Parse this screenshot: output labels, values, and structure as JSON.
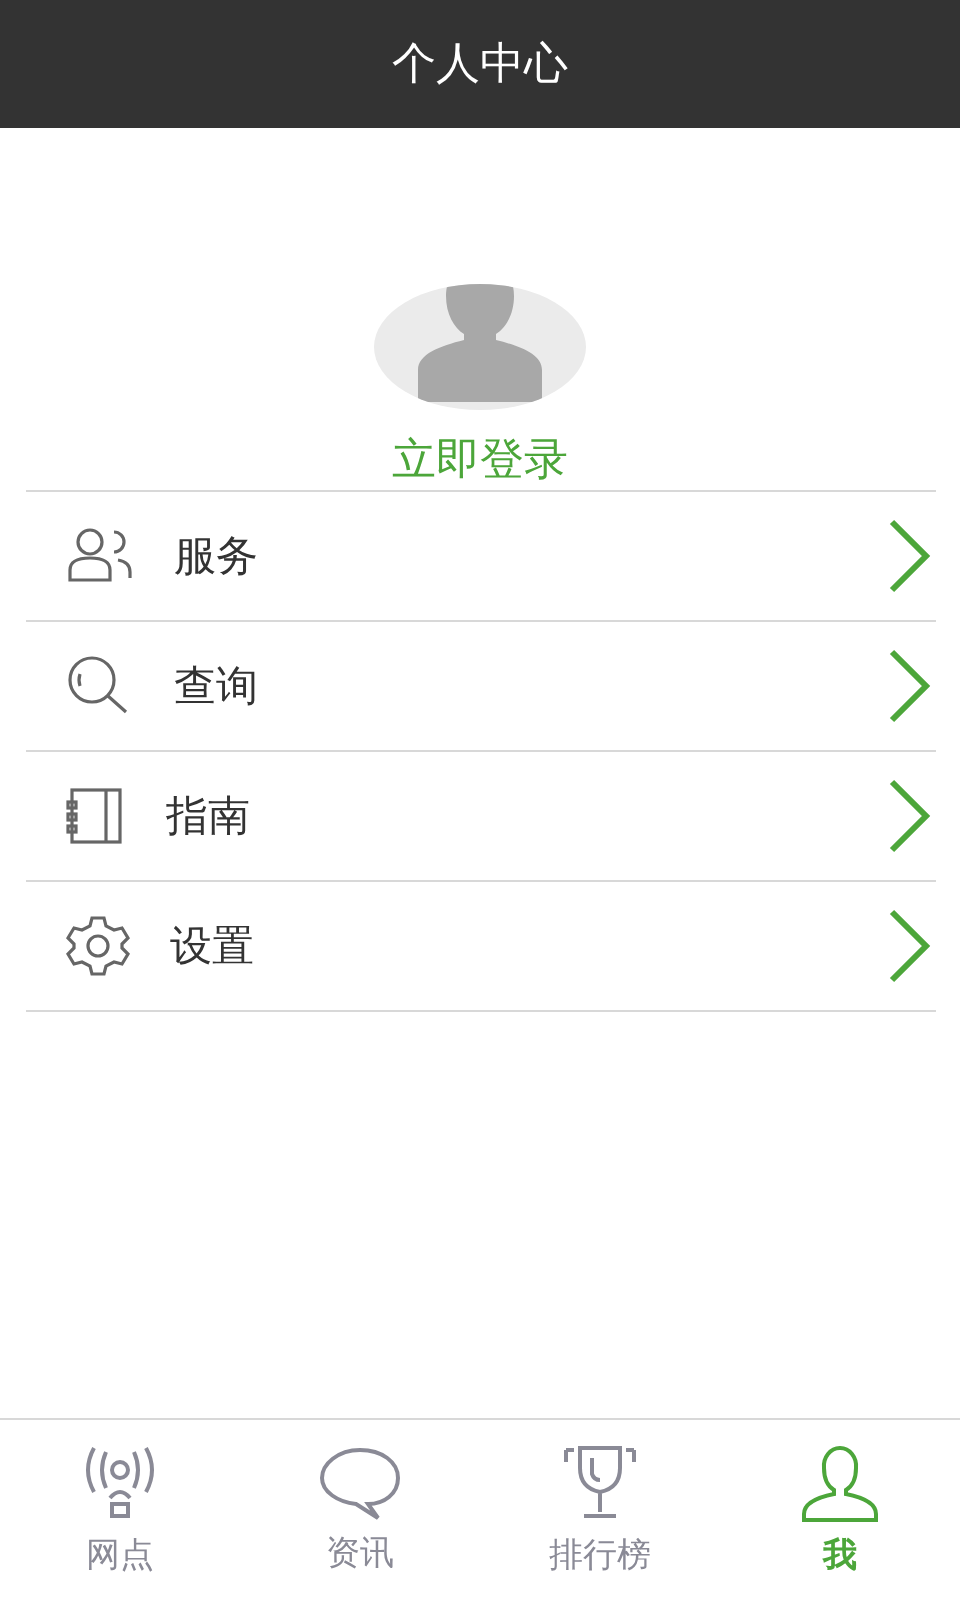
{
  "header": {
    "title": "个人中心"
  },
  "profile": {
    "login_label": "立即登录"
  },
  "menu": [
    {
      "kind": "service",
      "label": "服务"
    },
    {
      "kind": "search",
      "label": "查询"
    },
    {
      "kind": "guide",
      "label": "指南"
    },
    {
      "kind": "settings",
      "label": "设置"
    }
  ],
  "tab_bar": [
    {
      "kind": "outlet",
      "label": "网点",
      "selected": false
    },
    {
      "kind": "news",
      "label": "资讯",
      "selected": false
    },
    {
      "kind": "ranking",
      "label": "排行榜",
      "selected": false
    },
    {
      "kind": "me",
      "label": "我",
      "selected": true
    }
  ]
}
